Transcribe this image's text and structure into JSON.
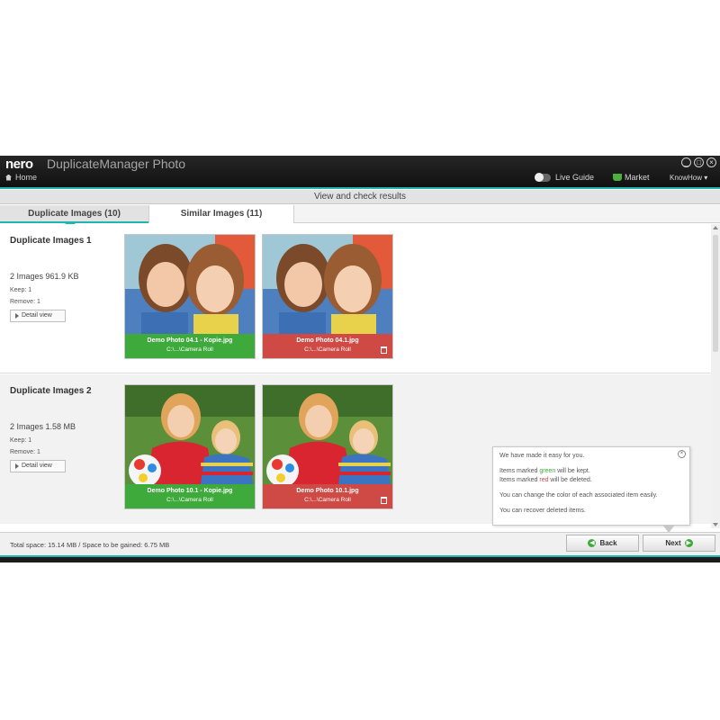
{
  "app": {
    "brand": "nero",
    "product": "DuplicateManager Photo",
    "home": "Home",
    "live_guide": "Live Guide",
    "market": "Market",
    "knowhow": "KnowHow ▾",
    "window_buttons": [
      "_",
      "□",
      "×"
    ]
  },
  "header": {
    "title": "View and check results"
  },
  "tabs": [
    {
      "label": "Duplicate Images (10)",
      "active": true
    },
    {
      "label": "Similar Images (11)",
      "active": false
    }
  ],
  "groups": [
    {
      "title": "Duplicate Images 1",
      "size": "2 Images  961.9 KB",
      "keep": "Keep: 1",
      "remove": "Remove: 1",
      "detail_label": "Detail view",
      "cards": [
        {
          "name": "Demo Photo 04.1 - Kopie.jpg",
          "path": "C:\\...\\Camera Roll",
          "status": "keep"
        },
        {
          "name": "Demo Photo 04.1.jpg",
          "path": "C:\\...\\Camera Roll",
          "status": "delete"
        }
      ]
    },
    {
      "title": "Duplicate Images 2",
      "size": "2 Images  1.58 MB",
      "keep": "Keep: 1",
      "remove": "Remove: 1",
      "detail_label": "Detail view",
      "cards": [
        {
          "name": "Demo Photo 10.1 - Kopie.jpg",
          "path": "C:\\...\\Camera Roll",
          "status": "keep"
        },
        {
          "name": "Demo Photo 10.1.jpg",
          "path": "C:\\...\\Camera Roll",
          "status": "delete"
        }
      ]
    }
  ],
  "tooltip": {
    "heading": "We have made it easy for you.",
    "line1_prefix": "Items marked ",
    "line1_color": "green",
    "line1_suffix": " will be kept.",
    "line2_prefix": "Items marked ",
    "line2_color": "red",
    "line2_suffix": " will be deleted.",
    "line3": "You can change the color of each associated item easily.",
    "line4": "You can recover deleted items.",
    "close": "×"
  },
  "status": {
    "text": "Total space: 15.14 MB / Space to be gained: 6.75 MB",
    "back": "Back",
    "next": "Next"
  },
  "colors": {
    "accent": "#1fb6b0",
    "keep": "#3faa3c",
    "delete": "#cf4a45"
  }
}
